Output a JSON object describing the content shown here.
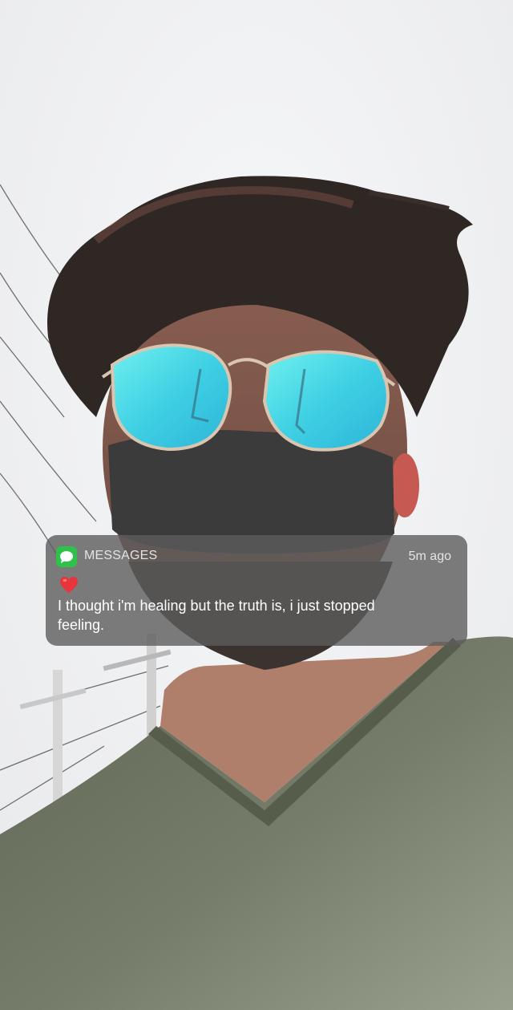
{
  "notification": {
    "app_icon": "messages-icon",
    "app_name": "MESSAGES",
    "time": "5m ago",
    "emoji": "red-heart-icon",
    "message": "I thought i'm healing but the truth is, i just stopped feeling."
  },
  "colors": {
    "notification_bg": "#5c5c5c",
    "messages_green": "#2fc24a",
    "heart_red": "#e8343a",
    "sky": "#eeeff1"
  }
}
